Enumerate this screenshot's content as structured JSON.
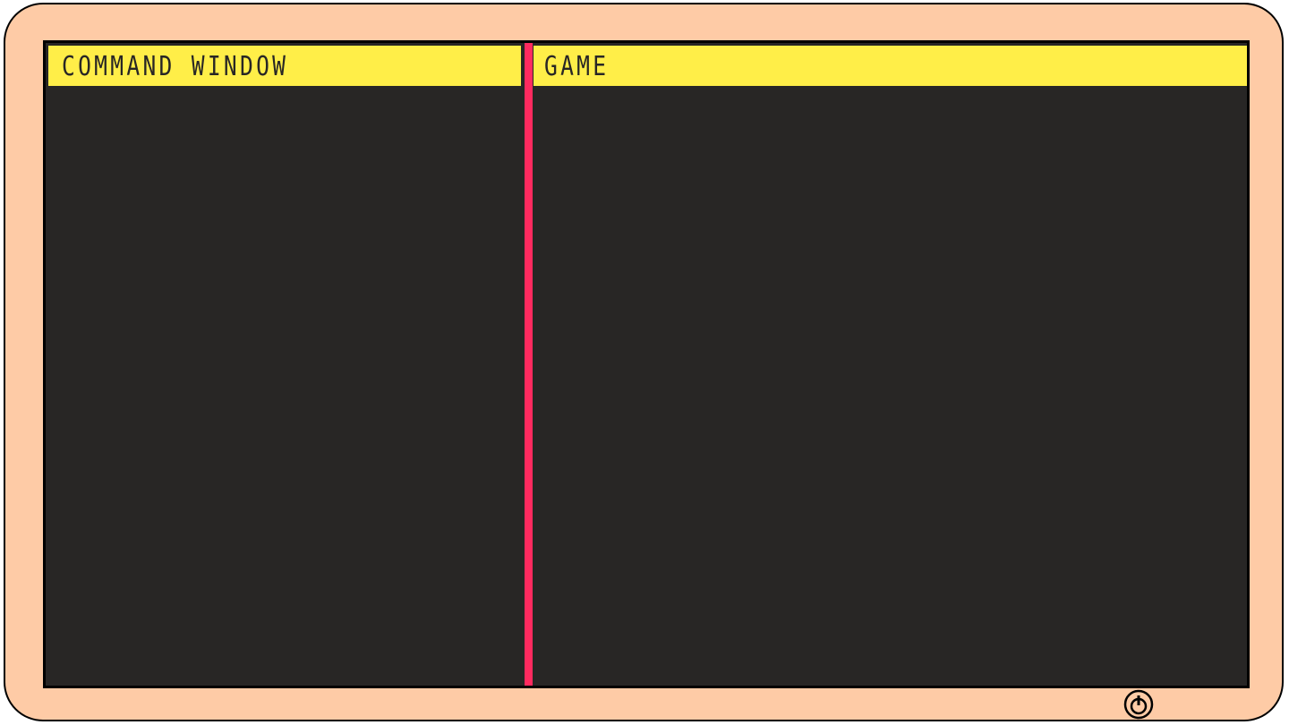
{
  "panels": {
    "command": {
      "title": "COMMAND WINDOW"
    },
    "game": {
      "title": "GAME"
    }
  },
  "icons": {
    "power": "power-icon"
  },
  "colors": {
    "bezel": "#fecba6",
    "screen_background": "#282625",
    "header_background": "#ffee48",
    "divider": "#ff2a5f",
    "outline": "#000000"
  }
}
